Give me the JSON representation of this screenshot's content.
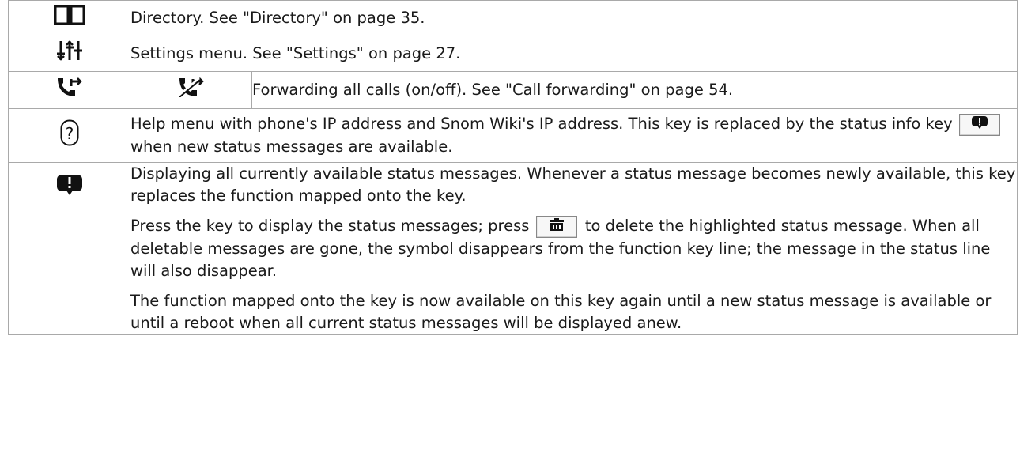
{
  "rows": [
    {
      "icon": "directory-icon",
      "text": "Directory.  See \"Directory\" on page 35."
    },
    {
      "icon": "settings-sliders-icon",
      "text": "Settings menu.  See \"Settings\" on page 27."
    },
    {
      "icon": "call-forward-on-icon",
      "icon2": "call-forward-off-icon",
      "text": "Forwarding all calls (on/off).  See \"Call forwarding\" on page 54."
    },
    {
      "icon": "help-question-icon",
      "text_before": "Help menu with phone's IP address and Snom Wiki's IP address.  This key is replaced by the status info key",
      "inline_key_icon": "status-info-icon",
      "text_after": "when new status messages are available."
    },
    {
      "icon": "status-info-icon",
      "para1": "Displaying all currently available status messages.  Whenever a status message becomes newly available, this key replaces the function mapped onto the key.",
      "para2_before": "Press the key to display the status messages;  press",
      "inline_key_icon": "delete-trash-icon",
      "para2_after": "to delete the highlighted status message.  When all deletable messages are gone, the symbol disappears from the function key line; the message in the status line will also disappear.",
      "para3": "The function mapped onto the key is now available on this key again until a new status message is available or until a reboot when all current status messages will be displayed anew."
    }
  ]
}
